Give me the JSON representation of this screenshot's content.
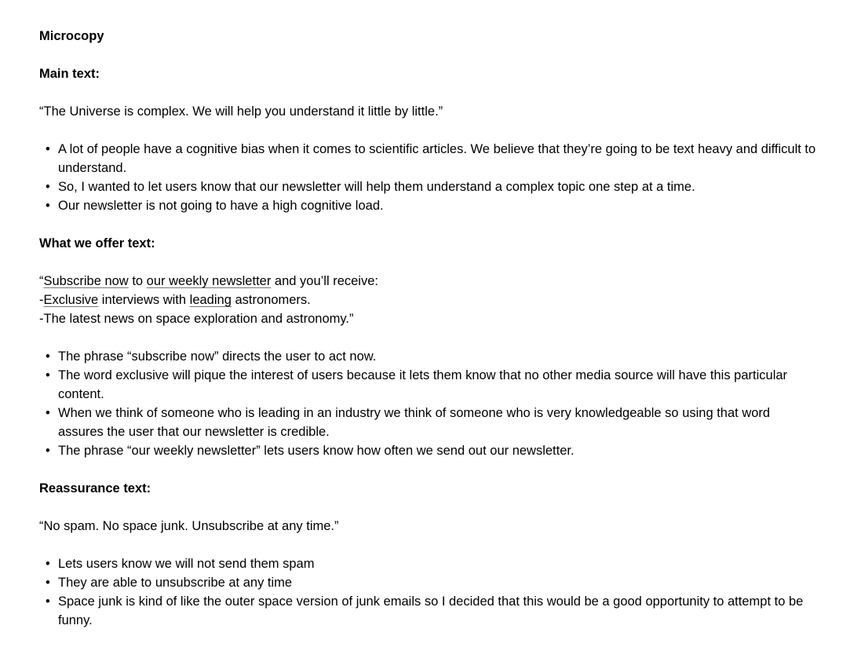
{
  "document": {
    "title": "Microcopy",
    "main_text": {
      "heading": "Main text:",
      "quote": "“The Universe is complex. We will help you understand it little by little.”",
      "bullets": [
        "A lot of people have a cognitive bias when it comes to scientific articles. We believe that they’re going to be text heavy and difficult to understand.",
        "So, I wanted to let users know that our newsletter will help them understand a complex topic one step at a time.",
        "Our newsletter is not going to have a high cognitive load."
      ]
    },
    "offer_text": {
      "heading": "What we offer text:",
      "line1": {
        "open_quote": "“",
        "subscribe_now": "Subscribe now",
        "to": " to ",
        "weekly_newsletter": "our weekly newsletter",
        "rest": " and you’ll receive:"
      },
      "line2": {
        "dash": "-",
        "exclusive": "Exclusive",
        "middle": " interviews with ",
        "leading": "leading",
        "rest": " astronomers."
      },
      "line3": "-The latest news on space exploration and astronomy.”",
      "bullets": [
        "The phrase “subscribe now” directs the user to act now.",
        "The word exclusive will pique the interest of users because it lets them know that no other media source will have this particular content.",
        "When we think of someone who is leading in an industry we think of someone who is very knowledgeable so using that word assures the user that our newsletter is credible.",
        "The phrase “our weekly newsletter” lets users know how often we send out our newsletter."
      ]
    },
    "reassurance_text": {
      "heading": "Reassurance text:",
      "quote": "“No spam. No space junk. Unsubscribe at any time.”",
      "bullets": [
        "Lets users know we will not send them spam",
        "They are able to unsubscribe at any time",
        "Space junk is kind of like the outer space version of junk emails so I decided that this would be a good opportunity to attempt to  be funny."
      ]
    }
  }
}
